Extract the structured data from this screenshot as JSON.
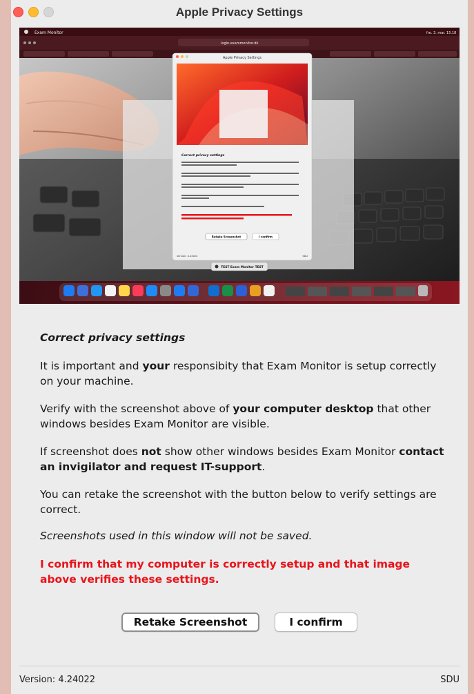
{
  "window": {
    "title": "Apple Privacy Settings"
  },
  "screenshot": {
    "menubar_app": "Exam Monitor",
    "menubar_clock": "fre. 3. mar. 15.18",
    "url": "login.exammonitor.dk",
    "inner_window_title": "Apple Privacy Settings",
    "inner_heading": "Correct privacy settings",
    "inner_retake": "Retake Screenshot",
    "inner_confirm": "I confirm",
    "inner_version": "Version: 4.24022",
    "inner_org": "SDU",
    "test_bar_label": "TEST Exam Monitor TEST"
  },
  "content": {
    "heading": "Correct privacy settings",
    "p1_a": "It is important and ",
    "p1_bold": "your",
    "p1_b": " responsibity that Exam Monitor is setup correctly on your machine.",
    "p2_a": "Verify with the screenshot above of ",
    "p2_bold": "your computer desktop",
    "p2_b": " that other windows besides Exam Monitor are visible.",
    "p3_a": "If screenshot does ",
    "p3_bold1": "not",
    "p3_b": " show other windows besides Exam Monitor ",
    "p3_bold2": "contact an invigilator and request IT-support",
    "p3_c": ".",
    "p4": "You can retake the screenshot with the button below to verify settings are correct.",
    "p5": "Screenshots used in this window will not be saved.",
    "confirm_statement": "I confirm that my computer is correctly setup and that image above verifies these settings."
  },
  "buttons": {
    "retake": "Retake Screenshot",
    "confirm": "I confirm"
  },
  "footer": {
    "version": "Version: 4.24022",
    "org": "SDU"
  }
}
